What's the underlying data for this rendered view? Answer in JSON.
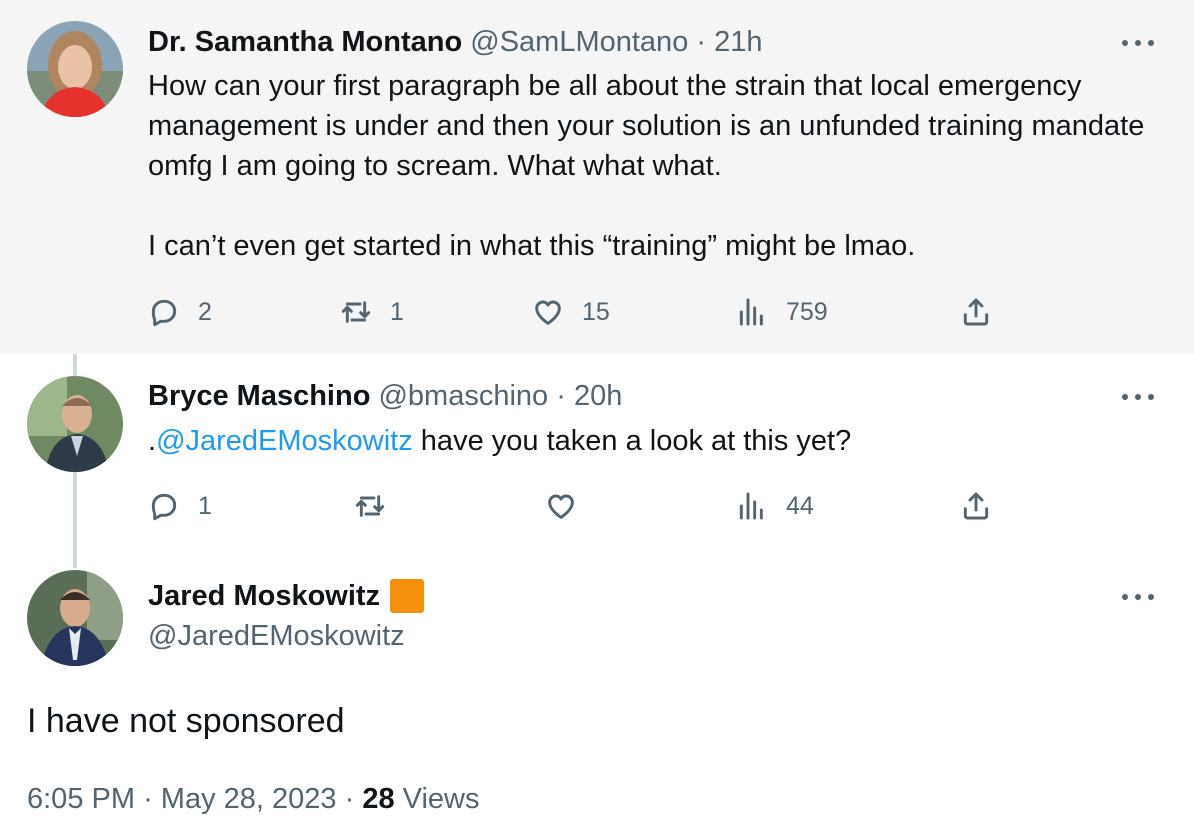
{
  "tweets": [
    {
      "name": "Dr. Samantha Montano",
      "handle": "@SamLMontano",
      "time": "21h",
      "text": "How can your first paragraph be all about the strain that local emergency management is under and then your solution is an unfunded training mandate omfg I am going to scream. What what what.\n\nI can’t even get started in what this “training” might be lmao.",
      "replies": "2",
      "retweets": "1",
      "likes": "15",
      "views": "759"
    },
    {
      "name": "Bryce Maschino",
      "handle": "@bmaschino",
      "time": "20h",
      "text_prefix": ".",
      "mention": "@JaredEMoskowitz",
      "text_suffix": " have you taken a look at this yet?",
      "replies": "1",
      "retweets": "",
      "likes": "",
      "views": "44"
    }
  ],
  "main": {
    "name": "Jared Moskowitz",
    "handle": "@JaredEMoskowitz",
    "badge_color": "#f4900c",
    "text": "I have not sponsored",
    "time": "6:05 PM",
    "date": "May 28, 2023",
    "views_count": "28",
    "views_label": "Views"
  },
  "separator": "·",
  "icons": {
    "more": "more-horizontal-icon",
    "reply": "reply-icon",
    "retweet": "retweet-icon",
    "like": "heart-icon",
    "views": "bar-chart-icon",
    "share": "share-icon"
  },
  "colors": {
    "accent": "#1d9bf0",
    "secondary_text": "#536471",
    "highlight_bg": "#f5f5f5",
    "thread_line": "#cfd9de"
  }
}
